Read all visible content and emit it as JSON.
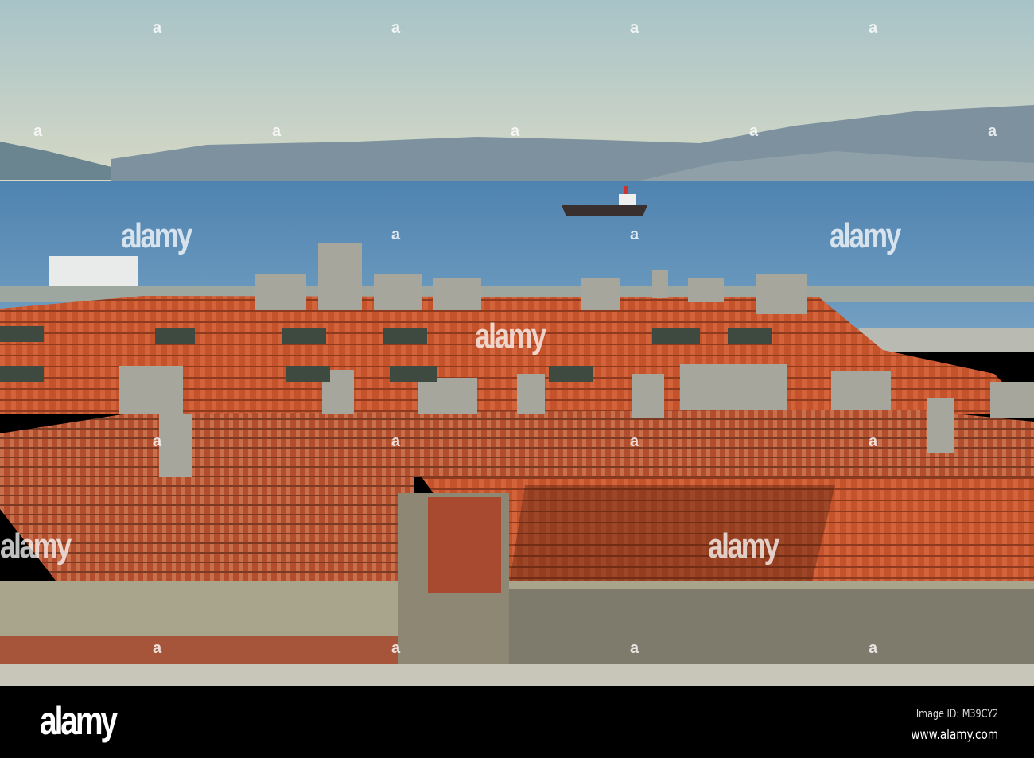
{
  "watermark": {
    "text": "alamy",
    "mark": "a"
  },
  "footer": {
    "logo": "alamy",
    "image_id": "Image ID: M39CY2",
    "url": "www.alamy.com"
  },
  "colors": {
    "sky": "#b5c9c6",
    "sea": "#5f8fb8",
    "roof": "#c2542e",
    "footer_bg": "#000000"
  }
}
